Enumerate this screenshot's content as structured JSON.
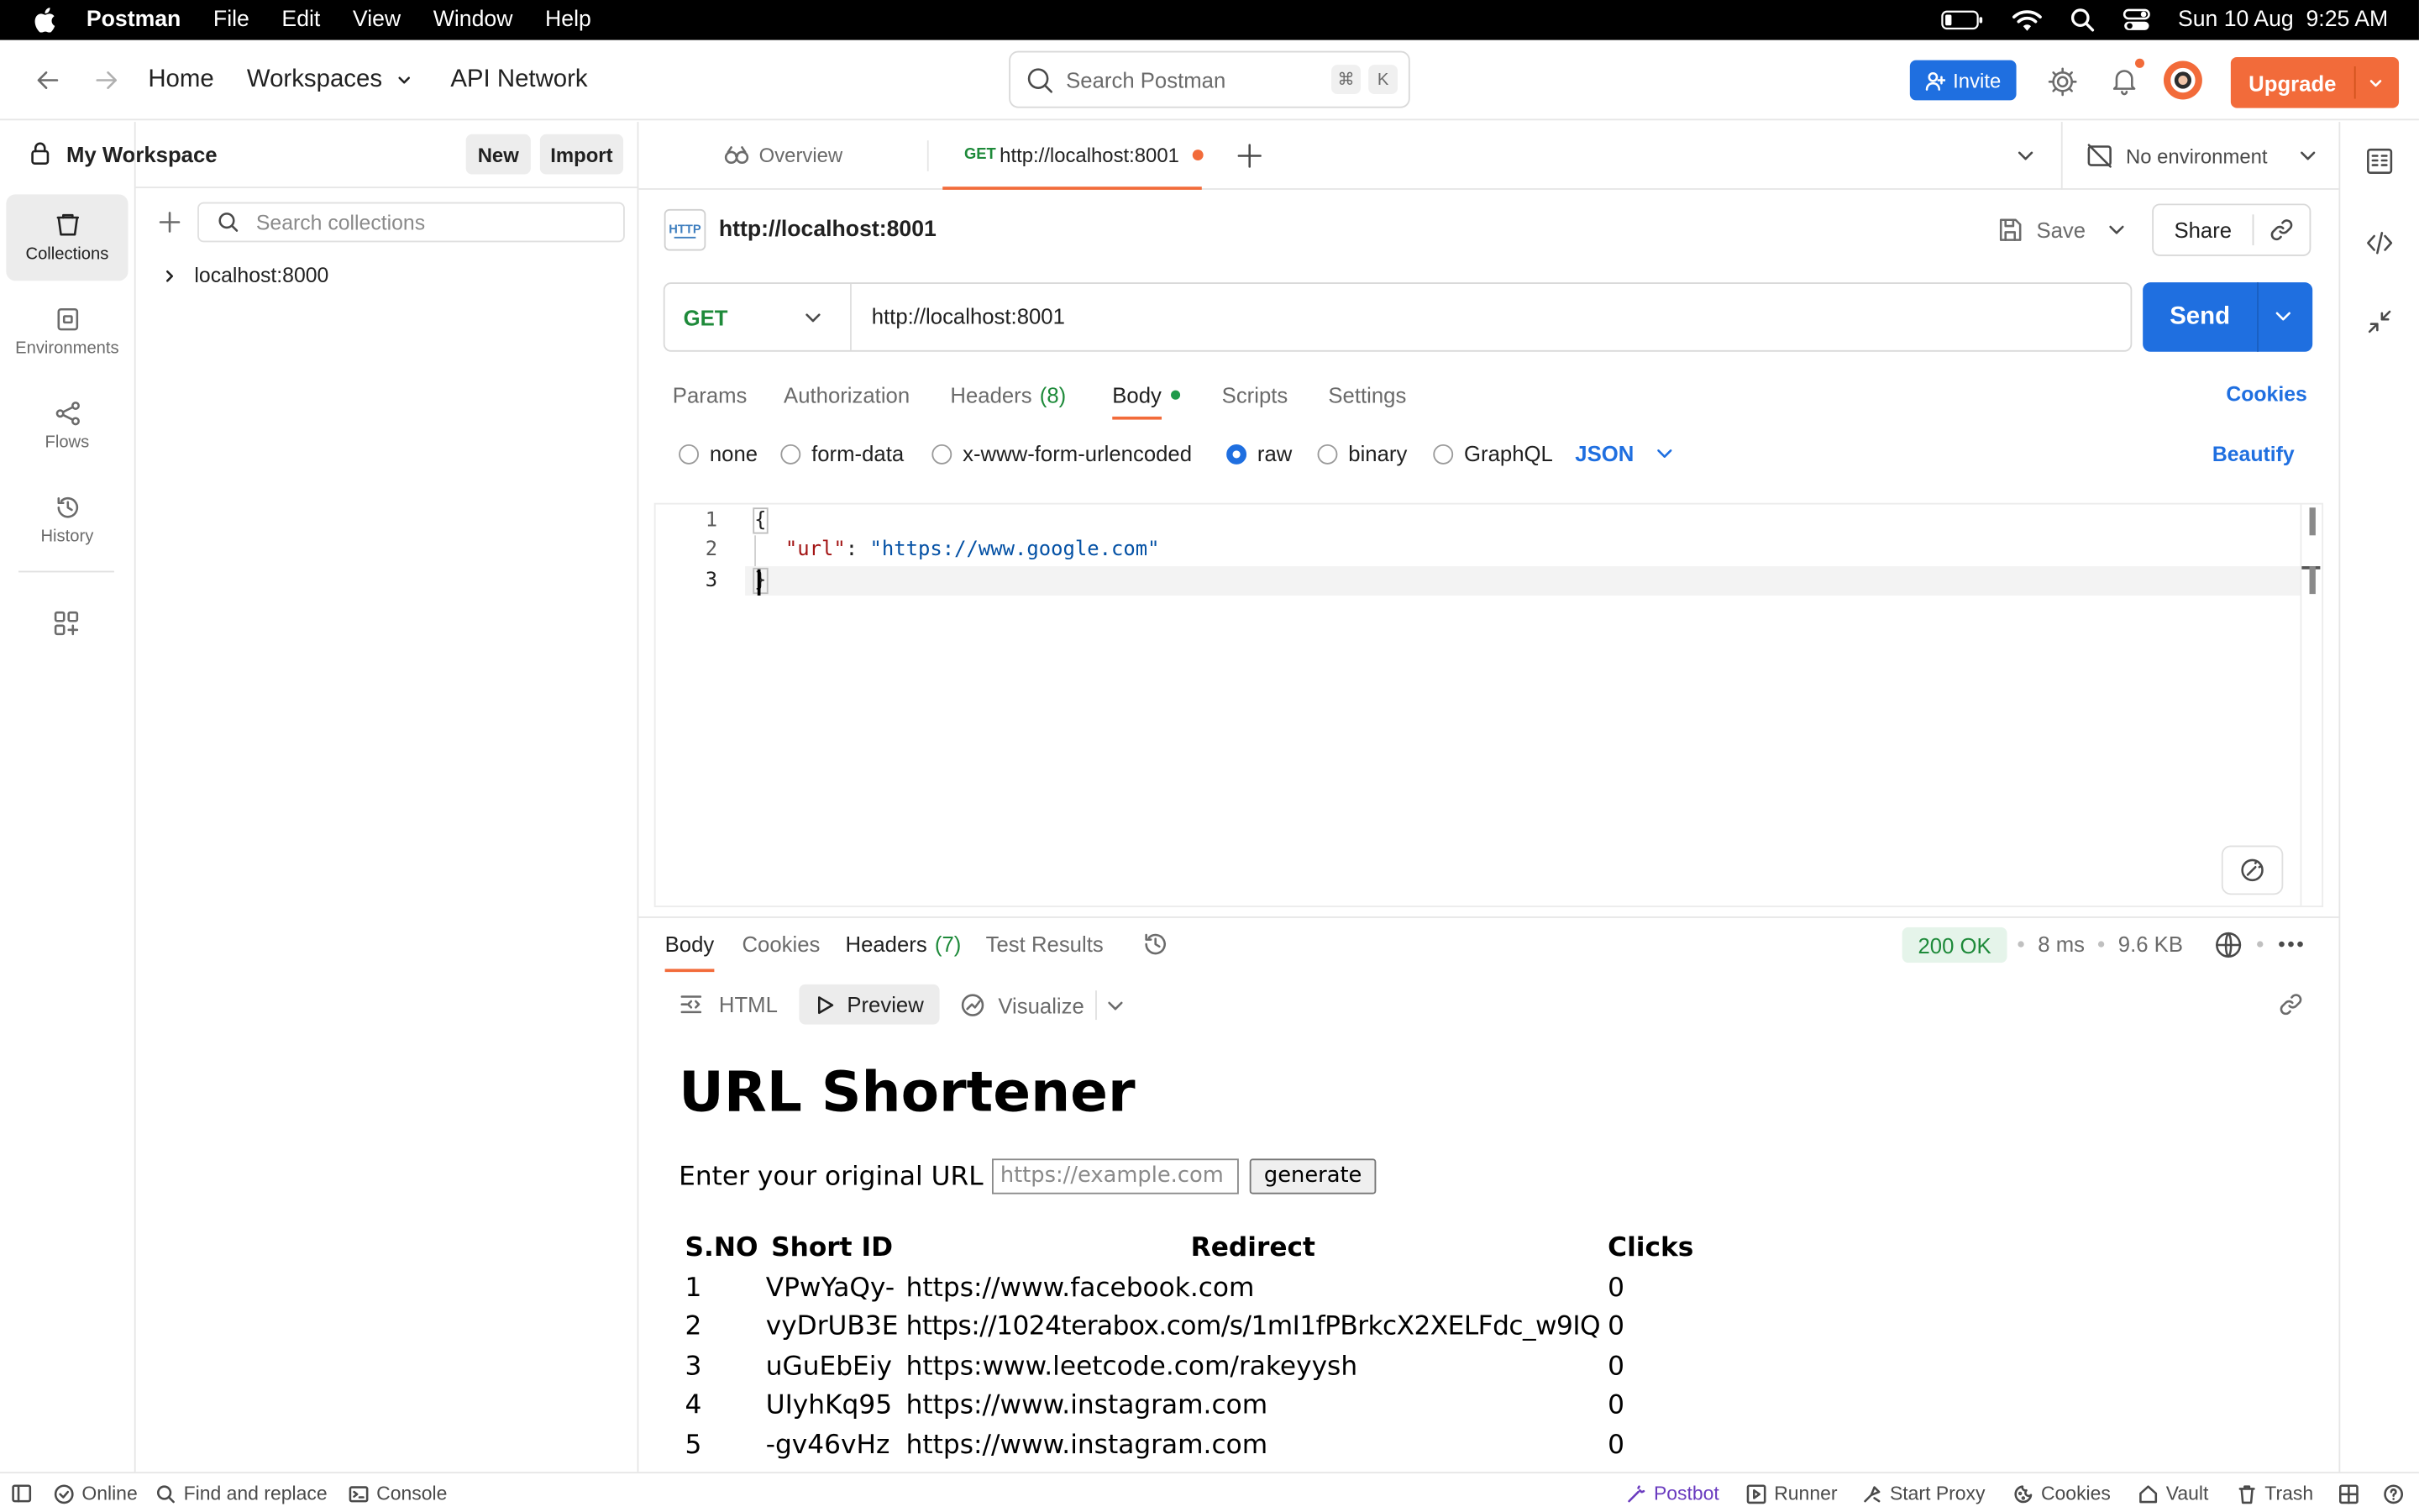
{
  "menubar": {
    "app": "Postman",
    "items": [
      "File",
      "Edit",
      "View",
      "Window",
      "Help"
    ],
    "datetime": "Sun 10 Aug  9:25 AM"
  },
  "header": {
    "home": "Home",
    "workspaces": "Workspaces",
    "api_network": "API Network",
    "search_placeholder": "Search Postman",
    "search_kbd_1": "⌘",
    "search_kbd_2": "K",
    "invite": "Invite",
    "upgrade": "Upgrade"
  },
  "rail": {
    "collections": "Collections",
    "environments": "Environments",
    "flows": "Flows",
    "history": "History"
  },
  "workspace": {
    "name": "My Workspace",
    "new": "New",
    "import": "Import",
    "search_placeholder": "Search collections",
    "tree": [
      "localhost:8000"
    ]
  },
  "tabs": {
    "overview": "Overview",
    "active_method": "GET",
    "active_url": "http://localhost:8001",
    "environment": "No environment"
  },
  "request": {
    "title": "http://localhost:8001",
    "save": "Save",
    "share": "Share",
    "method": "GET",
    "url": "http://localhost:8001",
    "send": "Send",
    "subtabs": {
      "params": "Params",
      "authorization": "Authorization",
      "headers": "Headers",
      "headers_count": "(8)",
      "body": "Body",
      "scripts": "Scripts",
      "settings": "Settings",
      "cookies": "Cookies"
    },
    "body_types": [
      "none",
      "form-data",
      "x-www-form-urlencoded",
      "raw",
      "binary",
      "GraphQL"
    ],
    "selected_body_type": "raw",
    "format": "JSON",
    "beautify": "Beautify",
    "code_lines": [
      "1",
      "2",
      "3"
    ],
    "code": {
      "open": "{",
      "key": "\"url\"",
      "colon": ": ",
      "value": "\"https://www.google.com\"",
      "close": "}"
    }
  },
  "response": {
    "tabs": {
      "body": "Body",
      "cookies": "Cookies",
      "headers": "Headers",
      "headers_count": "(7)",
      "test_results": "Test Results"
    },
    "status": "200 OK",
    "time": "8 ms",
    "size": "9.6 KB",
    "views": {
      "html": "HTML",
      "preview": "Preview",
      "visualize": "Visualize"
    },
    "preview": {
      "heading": "URL Shortener",
      "label": "Enter your original URL",
      "input_placeholder": "https://example.com",
      "generate": "generate",
      "columns": [
        "S.NO",
        "Short ID",
        "Redirect",
        "Clicks"
      ],
      "rows": [
        [
          "1",
          "VPwYaQy-",
          "https://www.facebook.com",
          "0"
        ],
        [
          "2",
          "vyDrUB3E",
          "https://1024terabox.com/s/1mI1fPBrkcX2XELFdc_w9IQ",
          "0"
        ],
        [
          "3",
          "uGuEbEiy",
          "https:www.leetcode.com/rakeyysh",
          "0"
        ],
        [
          "4",
          "UIyhKq95",
          "https://www.instagram.com",
          "0"
        ],
        [
          "5",
          "-gv46vHz",
          "https://www.instagram.com",
          "0"
        ]
      ]
    }
  },
  "statusbar": {
    "online": "Online",
    "find_replace": "Find and replace",
    "console": "Console",
    "postbot": "Postbot",
    "runner": "Runner",
    "start_proxy": "Start Proxy",
    "cookies": "Cookies",
    "vault": "Vault",
    "trash": "Trash"
  },
  "colors": {
    "accent": "#1f6fe0",
    "upgrade": "#f26b3a",
    "method_get": "#1e8a3a",
    "status_ok": "#1e8a3a",
    "json_key": "#a31515",
    "json_string": "#0451a5"
  }
}
